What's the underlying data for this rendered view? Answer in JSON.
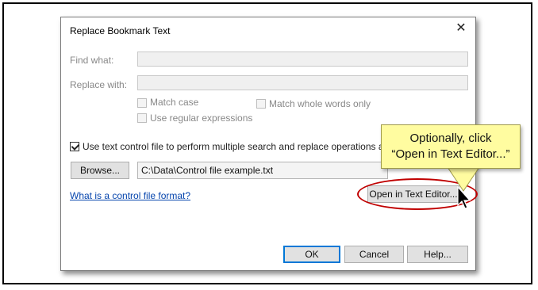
{
  "dialog": {
    "title": "Replace Bookmark Text",
    "close_glyph": "✕"
  },
  "find": {
    "label": "Find what:",
    "value": ""
  },
  "replace": {
    "label": "Replace with:",
    "value": ""
  },
  "options": {
    "match_case": {
      "label": "Match case",
      "checked": false
    },
    "match_whole": {
      "label": "Match whole words only",
      "checked": false
    },
    "regex": {
      "label": "Use regular expressions",
      "checked": false
    }
  },
  "control_file": {
    "checkbox_label": "Use text control file to perform multiple search and replace operations at once",
    "checked": true,
    "browse_label": "Browse...",
    "path": "C:\\Data\\Control file example.txt",
    "help_link": "What is a control file format?",
    "open_editor_label": "Open in Text Editor..."
  },
  "buttons": {
    "ok": "OK",
    "cancel": "Cancel",
    "help": "Help..."
  },
  "callout": {
    "line1": "Optionally, click",
    "line2": "“Open in Text Editor...”"
  },
  "colors": {
    "highlight": "#c00000",
    "callout_bg": "#fffca0",
    "link": "#0645ad",
    "default_button": "#0078d7"
  },
  "icons": {
    "close": "close-icon",
    "cursor": "mouse-pointer-icon"
  }
}
